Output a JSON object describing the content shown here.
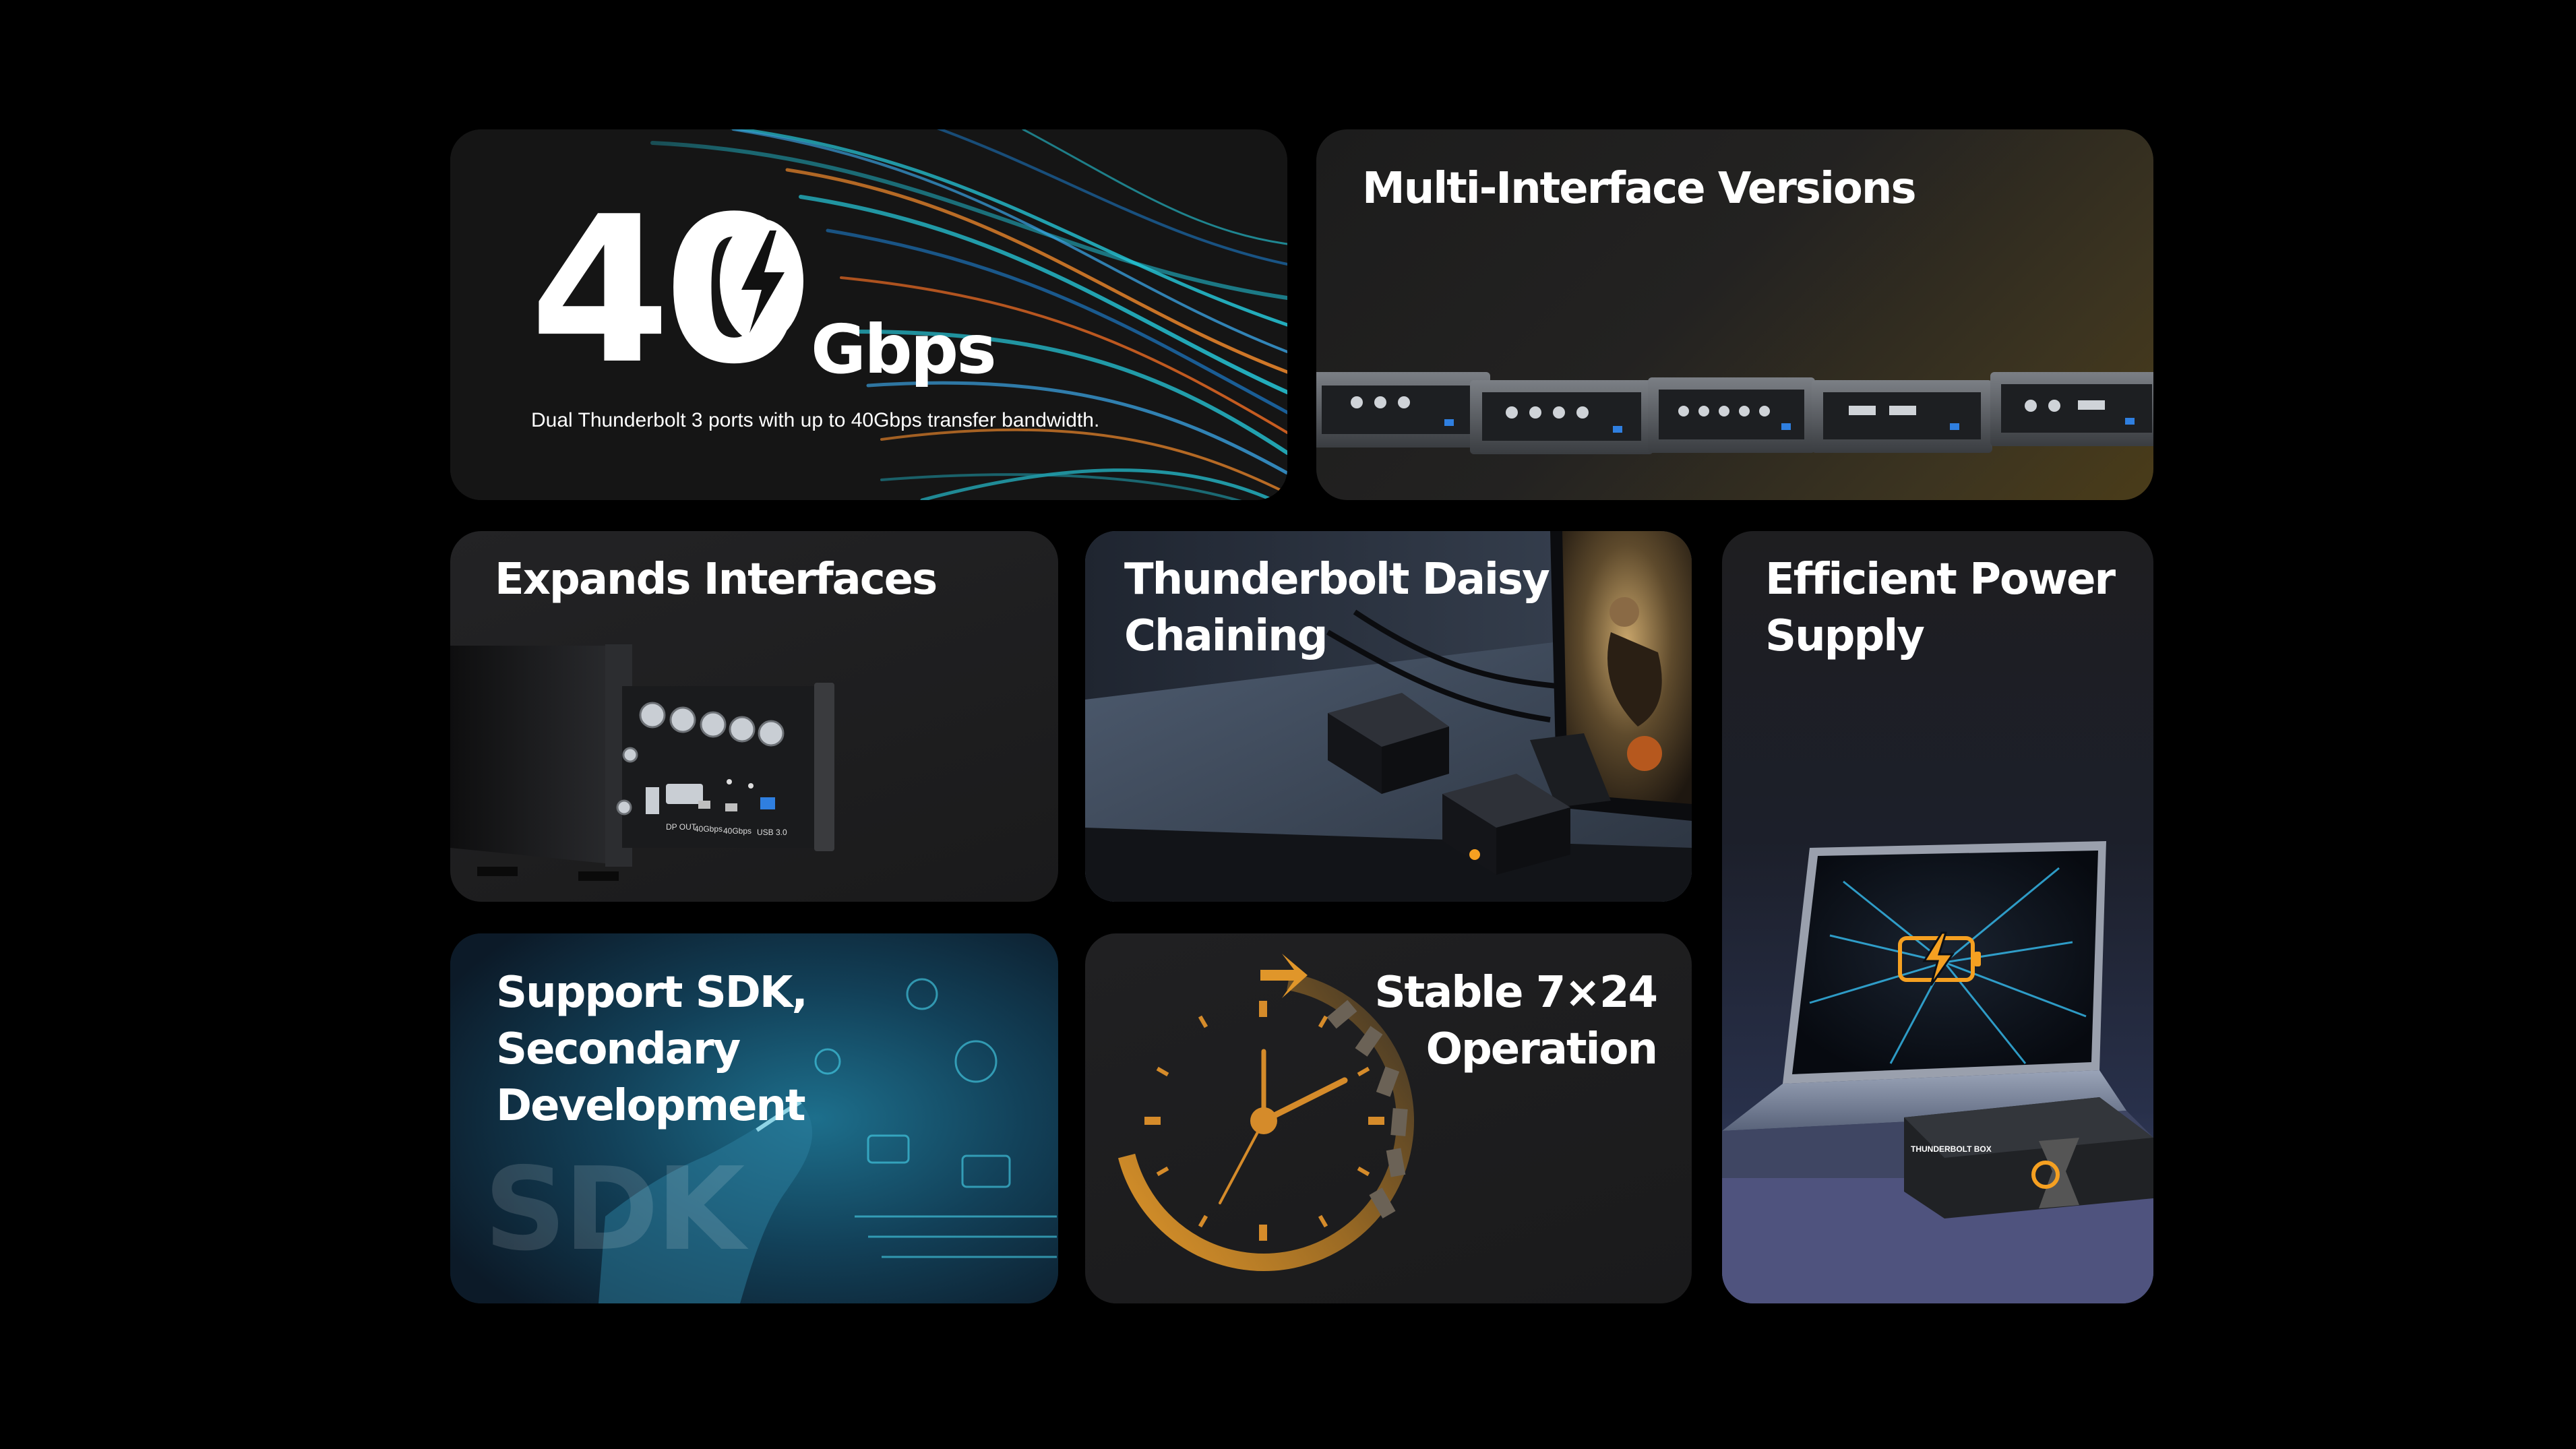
{
  "cards": {
    "bandwidth": {
      "number": "40",
      "unit": "Gbps",
      "caption": "Dual Thunderbolt 3 ports with up to 40Gbps transfer bandwidth."
    },
    "multi_interface": {
      "title": "Multi-Interface Versions"
    },
    "expands": {
      "title": "Expands Interfaces",
      "port_labels": [
        "DP OUT",
        "40Gbps",
        "40Gbps",
        "USB 3.0"
      ]
    },
    "daisy": {
      "title": "Thunderbolt Daisy\nChaining"
    },
    "power": {
      "title": "Efficient Power\nSupply",
      "box_label": "THUNDERBOLT BOX"
    },
    "sdk": {
      "title": "Support SDK,\nSecondary Development",
      "watermark": "SDK"
    },
    "stable": {
      "title": "Stable 7×24\nOperation"
    }
  },
  "colors": {
    "background": "#000000",
    "card": "#1b1b1d",
    "accent_orange": "#f5a021",
    "accent_cyan": "#27d3e6",
    "accent_gold": "#c9892a"
  },
  "icons": [
    "lightning-bolt-icon",
    "battery-charging-icon",
    "clock-icon",
    "circular-arrow-icon"
  ]
}
